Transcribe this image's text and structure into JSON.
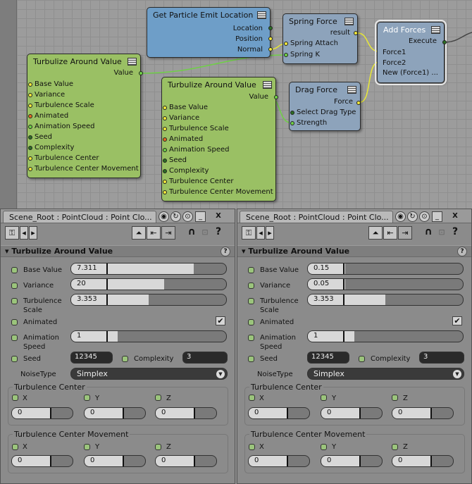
{
  "graph": {
    "nodes": {
      "emit": {
        "title": "Get Particle Emit Location",
        "ports": [
          "Location",
          "Position",
          "Normal"
        ]
      },
      "spring": {
        "title": "Spring Force",
        "out": "result",
        "ins": [
          "Spring Attach",
          "Spring K"
        ]
      },
      "add": {
        "title": "Add Forces",
        "out": "Execute",
        "ins": [
          "Force1",
          "Force2",
          "New (Force1) ..."
        ]
      },
      "drag": {
        "title": "Drag Force",
        "out": "Force",
        "ins": [
          "Select Drag Type",
          "Strength"
        ]
      },
      "turb1": {
        "title": "Turbulize Around Value",
        "out": "Value",
        "ins": [
          "Base Value",
          "Variance",
          "Turbulence Scale",
          "Animated",
          "Animation Speed",
          "Seed",
          "Complexity",
          "Turbulence Center",
          "Turbulence Center Movement"
        ]
      },
      "turb2": {
        "title": "Turbulize Around Value",
        "out": "Value",
        "ins": [
          "Base Value",
          "Variance",
          "Turbulence Scale",
          "Animated",
          "Animation Speed",
          "Seed",
          "Complexity",
          "Turbulence Center",
          "Turbulence Center Movement"
        ]
      }
    }
  },
  "panels": [
    {
      "title": "Scene_Root : PointCloud : Point Clo...",
      "section": "Turbulize Around Value",
      "fields": {
        "base_value": "7.311",
        "variance": "20",
        "turbulence_scale": "3.353",
        "animation_speed": "1",
        "seed": "12345",
        "complexity": "3",
        "noise_type": "Simplex"
      },
      "fills": {
        "base_value": 0.79,
        "variance": 0.6,
        "turbulence_scale": 0.5,
        "animation_speed": 0.3
      },
      "animated_checked": "✔",
      "center": {
        "x": "0",
        "y": "0",
        "z": "0"
      },
      "movement": {
        "x": "0",
        "y": "0",
        "z": "0"
      }
    },
    {
      "title": "Scene_Root : PointCloud : Point Clo...",
      "section": "Turbulize Around Value",
      "fields": {
        "base_value": "0.15",
        "variance": "0.05",
        "turbulence_scale": "3.353",
        "animation_speed": "1",
        "seed": "12345",
        "complexity": "3",
        "noise_type": "Simplex"
      },
      "fills": {
        "base_value": 0.24,
        "variance": 0.24,
        "turbulence_scale": 0.5,
        "animation_speed": 0.3
      },
      "animated_checked": "✔",
      "center": {
        "x": "0",
        "y": "0",
        "z": "0"
      },
      "movement": {
        "x": "0",
        "y": "0",
        "z": "0"
      }
    }
  ],
  "labels": {
    "base_value": "Base Value",
    "variance": "Variance",
    "turbulence_scale_1": "Turbulence",
    "turbulence_scale_2": "Scale",
    "animated": "Animated",
    "animation_speed_1": "Animation",
    "animation_speed_2": "Speed",
    "seed": "Seed",
    "complexity": "Complexity",
    "noise_type": "NoiseType",
    "turbulence_center": "Turbulence Center",
    "turbulence_center_movement": "Turbulence Center Movement",
    "x": "X",
    "y": "Y",
    "z": "Z"
  },
  "icons": [
    "key-icon",
    "arrow-left-icon",
    "arrow-right-icon",
    "eye-icon",
    "refresh-icon",
    "lock-icon",
    "minimize-icon",
    "close-icon",
    "help-icon",
    "magnet-icon",
    "copy-icon",
    "paste-icon"
  ]
}
